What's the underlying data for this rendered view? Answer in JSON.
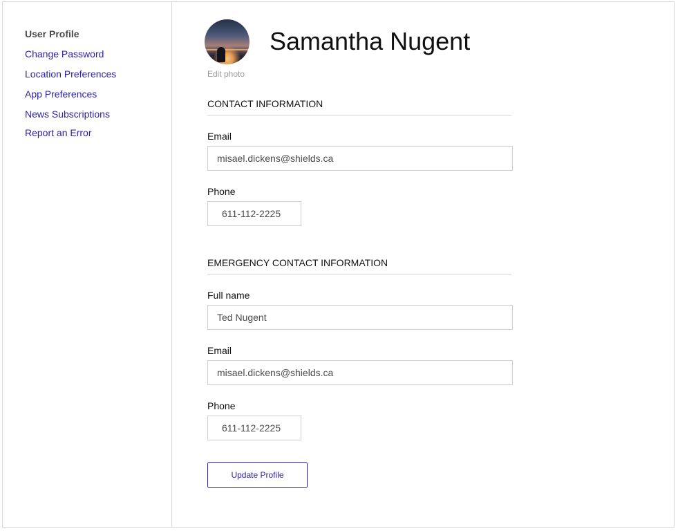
{
  "sidebar": {
    "heading": "User Profile",
    "items": [
      {
        "label": "Change Password"
      },
      {
        "label": "Location Preferences"
      },
      {
        "label": "App Preferences"
      },
      {
        "label": "News Subscriptions"
      },
      {
        "label": "Report an Error"
      }
    ]
  },
  "profile": {
    "name": "Samantha Nugent",
    "edit_photo": "Edit photo",
    "avatar_icon": "sunset-photo-avatar"
  },
  "contact": {
    "title": "CONTACT INFORMATION",
    "email_label": "Email",
    "email_value": "misael.dickens@shields.ca",
    "phone_label": "Phone",
    "phone_value": "611-112-2225"
  },
  "emergency": {
    "title": "EMERGENCY CONTACT INFORMATION",
    "name_label": "Full name",
    "name_value": "Ted Nugent",
    "email_label": "Email",
    "email_value": "misael.dickens@shields.ca",
    "phone_label": "Phone",
    "phone_value": "611-112-2225"
  },
  "actions": {
    "update_label": "Update Profile"
  },
  "colors": {
    "link": "#2b22a8",
    "border": "#d6d6d6",
    "heading": "#4a4a4a"
  }
}
